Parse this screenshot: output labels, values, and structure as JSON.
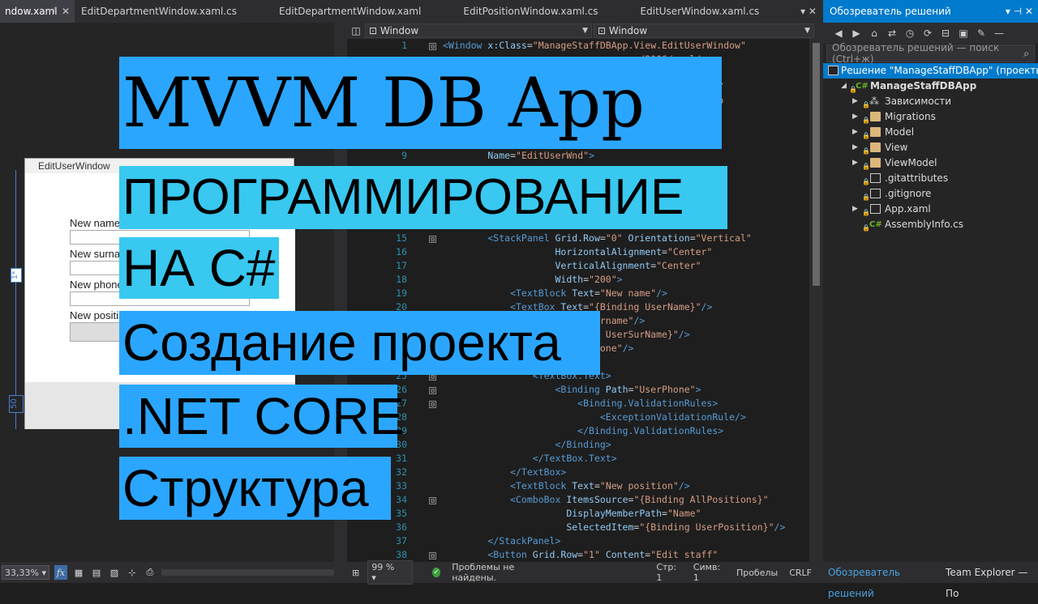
{
  "tabs": [
    {
      "label": "ndow.xaml",
      "active": true
    },
    {
      "label": "EditDepartmentWindow.xaml.cs"
    },
    {
      "label": "EditDepartmentWindow.xaml"
    },
    {
      "label": "EditPositionWindow.xaml.cs"
    },
    {
      "label": "EditUserWindow.xaml.cs"
    }
  ],
  "tab_controls": {
    "pin": "⊣",
    "close": "✕",
    "overflow": "▾ ✕"
  },
  "designer": {
    "window_title": "EditUserWindow",
    "labels": [
      "New name",
      "New surna",
      "New phone",
      "New positi"
    ],
    "ruler_top": "1*",
    "ruler_bottom": "50"
  },
  "design_toolbar": {
    "zoom": "33,33%",
    "fx": "fx"
  },
  "editor": {
    "nav_left": "Window",
    "nav_right": "Window",
    "lines": [
      {
        "n": "1",
        "parts": [
          [
            "tag",
            "<Window "
          ],
          [
            "attr",
            "x:Class"
          ],
          [
            "txt",
            "="
          ],
          [
            "str",
            "\"ManageStaffDBApp.View.EditUserWindow\""
          ]
        ],
        "fold": "⊟"
      },
      {
        "n": "",
        "parts": [
          [
            "str",
            "                                   /2006/xaml/pre"
          ]
        ]
      },
      {
        "n": "",
        "parts": [
          [
            "str",
            "                                   xfx/2006/xaml\""
          ]
        ]
      },
      {
        "n": "",
        "parts": [
          [
            "str",
            "                                   pression/blend/"
          ]
        ]
      },
      {
        "n": "",
        "parts": [
          [
            "str",
            "                                   org/markup-comp"
          ]
        ]
      },
      {
        "n": "",
        "parts": [
          [
            "str",
            "                                   pp.View\""
          ]
        ]
      },
      {
        "n": "",
        "parts": []
      },
      {
        "n": "",
        "parts": [
          [
            "str",
            "                                   =\"300\""
          ]
        ]
      },
      {
        "n": "9",
        "parts": [
          [
            "attr",
            "        Name"
          ],
          [
            "txt",
            "="
          ],
          [
            "str",
            "\"EditUserWnd\""
          ],
          [
            "tag",
            ">"
          ]
        ]
      },
      {
        "n": "",
        "parts": []
      },
      {
        "n": "",
        "parts": []
      },
      {
        "n": "",
        "parts": []
      },
      {
        "n": "",
        "parts": []
      },
      {
        "n": "",
        "parts": []
      },
      {
        "n": "15",
        "parts": [
          [
            "tag",
            "        <StackPanel "
          ],
          [
            "attr",
            "Grid.Row"
          ],
          [
            "txt",
            "="
          ],
          [
            "str",
            "\"0\" "
          ],
          [
            "attr",
            "Orientation"
          ],
          [
            "txt",
            "="
          ],
          [
            "str",
            "\"Vertical\""
          ]
        ],
        "fold": "⊟"
      },
      {
        "n": "16",
        "parts": [
          [
            "attr",
            "                    HorizontalAlignment"
          ],
          [
            "txt",
            "="
          ],
          [
            "str",
            "\"Center\""
          ]
        ]
      },
      {
        "n": "17",
        "parts": [
          [
            "attr",
            "                    VerticalAlignment"
          ],
          [
            "txt",
            "="
          ],
          [
            "str",
            "\"Center\""
          ]
        ]
      },
      {
        "n": "18",
        "parts": [
          [
            "attr",
            "                    Width"
          ],
          [
            "txt",
            "="
          ],
          [
            "str",
            "\"200\""
          ],
          [
            "tag",
            ">"
          ]
        ]
      },
      {
        "n": "19",
        "parts": [
          [
            "tag",
            "            <TextBlock "
          ],
          [
            "attr",
            "Text"
          ],
          [
            "txt",
            "="
          ],
          [
            "str",
            "\"New name\""
          ],
          [
            "tag",
            "/>"
          ]
        ]
      },
      {
        "n": "20",
        "parts": [
          [
            "tag",
            "            <TextBox "
          ],
          [
            "attr",
            "Text"
          ],
          [
            "txt",
            "="
          ],
          [
            "str",
            "\"{Binding UserName}\""
          ],
          [
            "tag",
            "/>"
          ]
        ]
      },
      {
        "n": "",
        "parts": [
          [
            "str",
            "                     \"New surname\""
          ],
          [
            "tag",
            "/>"
          ]
        ]
      },
      {
        "n": "",
        "parts": [
          [
            "str",
            "                     Binding UserSurName}\""
          ],
          [
            "tag",
            "/>"
          ]
        ]
      },
      {
        "n": "",
        "parts": [
          [
            "str",
            "                     \"New phone\""
          ],
          [
            "tag",
            "/>"
          ]
        ]
      },
      {
        "n": "",
        "parts": []
      },
      {
        "n": "25",
        "parts": [
          [
            "tag",
            "                <TextBox.Text>"
          ]
        ],
        "fold": "⊟"
      },
      {
        "n": "26",
        "parts": [
          [
            "tag",
            "                    <Binding "
          ],
          [
            "attr",
            "Path"
          ],
          [
            "txt",
            "="
          ],
          [
            "str",
            "\"UserPhone\""
          ],
          [
            "tag",
            ">"
          ]
        ],
        "fold": "⊟"
      },
      {
        "n": "27",
        "parts": [
          [
            "tag",
            "                        <Binding.ValidationRules>"
          ]
        ],
        "fold": "⊟"
      },
      {
        "n": "28",
        "parts": [
          [
            "tag",
            "                            <ExceptionValidationRule/>"
          ]
        ]
      },
      {
        "n": "29",
        "parts": [
          [
            "tag",
            "                        </Binding.ValidationRules>"
          ]
        ]
      },
      {
        "n": "30",
        "parts": [
          [
            "tag",
            "                    </Binding>"
          ]
        ]
      },
      {
        "n": "31",
        "parts": [
          [
            "tag",
            "                </TextBox.Text>"
          ]
        ]
      },
      {
        "n": "32",
        "parts": [
          [
            "tag",
            "            </TextBox>"
          ]
        ]
      },
      {
        "n": "33",
        "parts": [
          [
            "tag",
            "            <TextBlock "
          ],
          [
            "attr",
            "Text"
          ],
          [
            "txt",
            "="
          ],
          [
            "str",
            "\"New position\""
          ],
          [
            "tag",
            "/>"
          ]
        ]
      },
      {
        "n": "34",
        "parts": [
          [
            "tag",
            "            <ComboBox "
          ],
          [
            "attr",
            "ItemsSource"
          ],
          [
            "txt",
            "="
          ],
          [
            "str",
            "\"{Binding AllPositions}\""
          ]
        ],
        "fold": "⊟"
      },
      {
        "n": "35",
        "parts": [
          [
            "attr",
            "                      DisplayMemberPath"
          ],
          [
            "txt",
            "="
          ],
          [
            "str",
            "\"Name\""
          ]
        ]
      },
      {
        "n": "36",
        "parts": [
          [
            "attr",
            "                      SelectedItem"
          ],
          [
            "txt",
            "="
          ],
          [
            "str",
            "\"{Binding UserPosition}\""
          ],
          [
            "tag",
            "/>"
          ]
        ]
      },
      {
        "n": "37",
        "parts": [
          [
            "tag",
            "        </StackPanel>"
          ]
        ]
      },
      {
        "n": "38",
        "parts": [
          [
            "tag",
            "        <Button "
          ],
          [
            "attr",
            "Grid.Row"
          ],
          [
            "txt",
            "="
          ],
          [
            "str",
            "\"1\" "
          ],
          [
            "attr",
            "Content"
          ],
          [
            "txt",
            "="
          ],
          [
            "str",
            "\"Edit staff\""
          ]
        ],
        "fold": "⊟"
      }
    ]
  },
  "status": {
    "zoom": "99 %",
    "problems": "Проблемы не найдены.",
    "line": "Стр: 1",
    "col": "Симв: 1",
    "spaces": "Пробелы",
    "eol": "CRLF"
  },
  "solution_explorer": {
    "title": "Обозреватель решений",
    "title_controls": "▾ ⊣ ✕",
    "search_placeholder": "Обозреватель решений — поиск (Ctrl+ж)",
    "solution": "Решение \"ManageStaffDBApp\" (проекты",
    "project": "ManageStaffDBApp",
    "items": [
      {
        "label": "Зависимости",
        "kind": "deps",
        "expand": true
      },
      {
        "label": "Migrations",
        "kind": "folder",
        "expand": true
      },
      {
        "label": "Model",
        "kind": "folder",
        "expand": true
      },
      {
        "label": "View",
        "kind": "folder",
        "expand": true
      },
      {
        "label": "ViewModel",
        "kind": "folder",
        "expand": true
      },
      {
        "label": ".gitattributes",
        "kind": "file",
        "expand": false
      },
      {
        "label": ".gitignore",
        "kind": "file",
        "expand": false
      },
      {
        "label": "App.xaml",
        "kind": "file",
        "expand": true
      },
      {
        "label": "AssemblyInfo.cs",
        "kind": "cs",
        "expand": false
      }
    ],
    "bottom_tabs": [
      "Обозреватель решений",
      "Team Explorer — По"
    ]
  },
  "overlay": {
    "line1": "MVVM DB App",
    "line2": "ПРОГРАММИРОВАНИЕ",
    "line3": "НА C#",
    "line4": "Создание проекта",
    "line5": ".NET CORE",
    "line6": "Структура"
  },
  "colors": {
    "overlay_blue": "#2ba6ff",
    "overlay_cyan": "#38c8f0",
    "vs_accent": "#007acc"
  }
}
